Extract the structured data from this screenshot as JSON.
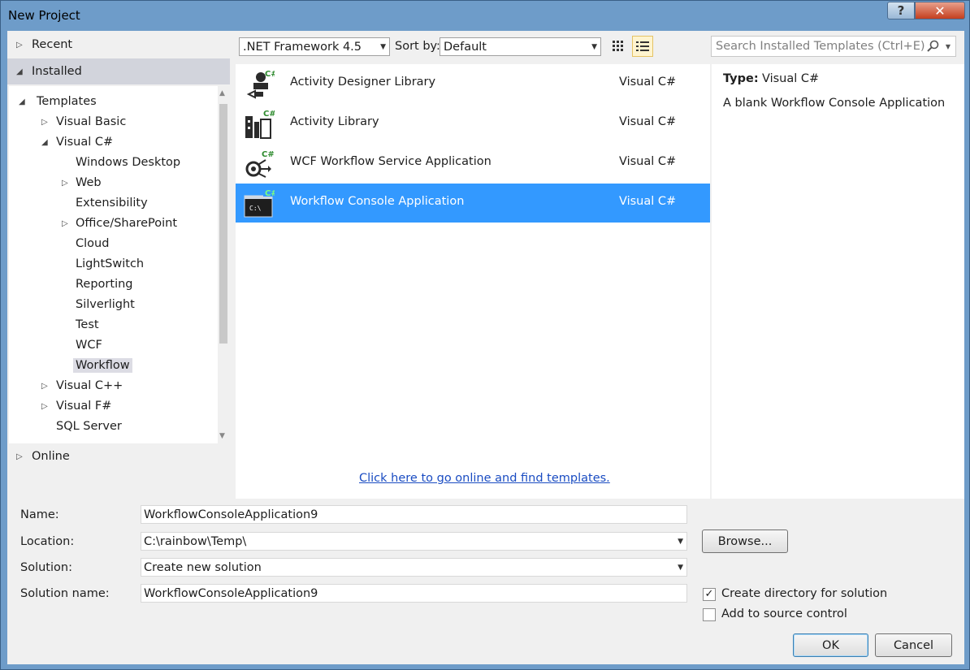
{
  "window": {
    "title": "New Project",
    "help_glyph": "?",
    "close_glyph": "✕"
  },
  "nav": {
    "recent": "Recent",
    "installed": "Installed",
    "online": "Online",
    "tree": [
      {
        "label": "Templates",
        "expanded": true
      },
      {
        "label": "Visual Basic",
        "expanded": false
      },
      {
        "label": "Visual C#",
        "expanded": true
      },
      {
        "label": "Windows Desktop"
      },
      {
        "label": "Web",
        "expanded": false
      },
      {
        "label": "Extensibility"
      },
      {
        "label": "Office/SharePoint",
        "expanded": false
      },
      {
        "label": "Cloud"
      },
      {
        "label": "LightSwitch"
      },
      {
        "label": "Reporting"
      },
      {
        "label": "Silverlight"
      },
      {
        "label": "Test"
      },
      {
        "label": "WCF"
      },
      {
        "label": "Workflow",
        "selected": true
      },
      {
        "label": "Visual C++",
        "expanded": false
      },
      {
        "label": "Visual F#",
        "expanded": false
      },
      {
        "label": "SQL Server"
      }
    ]
  },
  "toolbar": {
    "framework": ".NET Framework 4.5",
    "sort_label": "Sort by:",
    "sort_value": "Default",
    "search_placeholder": "Search Installed Templates (Ctrl+E)"
  },
  "templates": [
    {
      "name": "Activity Designer Library",
      "lang": "Visual C#"
    },
    {
      "name": "Activity Library",
      "lang": "Visual C#"
    },
    {
      "name": "WCF Workflow Service Application",
      "lang": "Visual C#"
    },
    {
      "name": "Workflow Console Application",
      "lang": "Visual C#",
      "selected": true
    }
  ],
  "online_link": "Click here to go online and find templates.",
  "details": {
    "type_label": "Type:",
    "type_value": "Visual C#",
    "description": "A blank Workflow Console Application"
  },
  "form": {
    "name_label": "Name:",
    "name_value": "WorkflowConsoleApplication9",
    "location_label": "Location:",
    "location_value": "C:\\rainbow\\Temp\\",
    "solution_label": "Solution:",
    "solution_value": "Create new solution",
    "solution_name_label": "Solution name:",
    "solution_name_value": "WorkflowConsoleApplication9",
    "browse": "Browse...",
    "create_dir_label": "Create directory for solution",
    "create_dir_checked": true,
    "source_control_label": "Add to source control",
    "source_control_checked": false,
    "ok": "OK",
    "cancel": "Cancel"
  },
  "colors": {
    "selection": "#3399ff",
    "link": "#1a4cc2",
    "csharp_badge": "#2e8b2e"
  }
}
